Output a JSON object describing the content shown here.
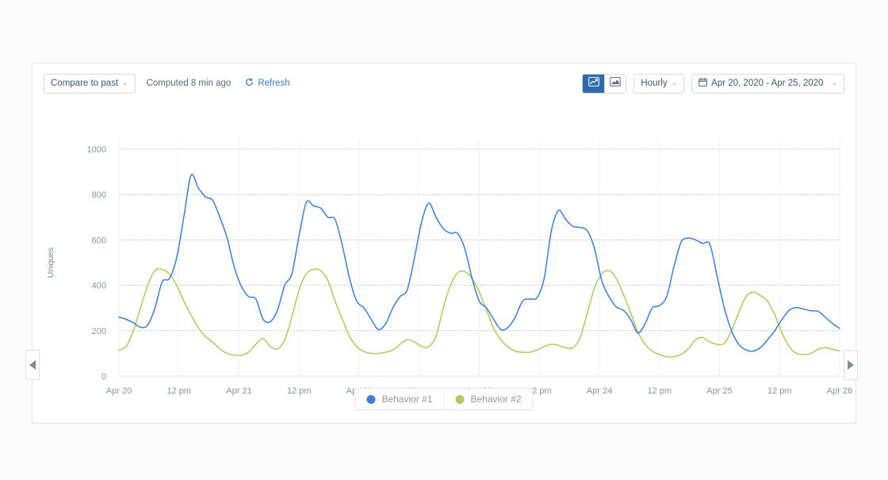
{
  "toolbar": {
    "compare_label": "Compare to past",
    "computed_label": "Computed 8 min ago",
    "refresh_label": "Refresh",
    "refresh_icon": "refresh-icon",
    "caret_glyph": "⌄",
    "chart_type_line_icon": "line-chart-icon",
    "chart_type_area_icon": "area-chart-icon",
    "granularity_label": "Hourly",
    "date_range_label": "Apr 20, 2020 - Apr 25, 2020",
    "calendar_icon": "calendar-icon"
  },
  "nav": {
    "prev_icon": "chevron-left-icon",
    "next_icon": "chevron-right-icon"
  },
  "legend": {
    "items": [
      {
        "label": "Behavior #1",
        "color": "#3b7dd8",
        "icon": "legend-dot-icon"
      },
      {
        "label": "Behavior #2",
        "color": "#a9cc5d",
        "icon": "legend-dot-icon"
      }
    ]
  },
  "chart_data": {
    "type": "line",
    "title": "",
    "xlabel": "",
    "ylabel": "Uniques",
    "ylim": [
      0,
      1000
    ],
    "yticks": [
      0,
      200,
      400,
      600,
      800,
      1000
    ],
    "xlim": [
      "Apr 20",
      "Apr 26"
    ],
    "xtick_labels": [
      "Apr 20",
      "12 pm",
      "Apr 21",
      "12 pm",
      "Apr 22",
      "12 pm",
      "Apr 23",
      "12 pm",
      "Apr 24",
      "12 pm",
      "Apr 25",
      "12 pm",
      "Apr 26"
    ],
    "grid": true,
    "grid_style": "dotted",
    "legend_position": "bottom",
    "granularity": "hourly",
    "x_days": 6,
    "series": [
      {
        "name": "Behavior #1",
        "color": "#3b7dd8",
        "values": [
          260,
          250,
          235,
          215,
          225,
          300,
          415,
          430,
          520,
          700,
          885,
          830,
          790,
          775,
          700,
          610,
          480,
          395,
          350,
          340,
          250,
          240,
          290,
          400,
          450,
          620,
          765,
          750,
          740,
          700,
          690,
          575,
          430,
          330,
          300,
          250,
          205,
          230,
          300,
          350,
          380,
          520,
          680,
          762,
          700,
          650,
          630,
          628,
          560,
          430,
          330,
          300,
          250,
          205,
          215,
          260,
          330,
          340,
          345,
          430,
          640,
          730,
          690,
          660,
          655,
          640,
          560,
          420,
          350,
          305,
          290,
          250,
          190,
          230,
          300,
          310,
          350,
          480,
          590,
          608,
          600,
          585,
          580,
          440,
          300,
          200,
          140,
          115,
          110,
          125,
          160,
          200,
          250,
          290,
          302,
          295,
          288,
          285,
          260,
          232,
          210
        ]
      },
      {
        "name": "Behavior #2",
        "color": "#a9cc5d",
        "values": [
          115,
          130,
          200,
          300,
          400,
          465,
          470,
          450,
          400,
          330,
          270,
          215,
          175,
          150,
          120,
          100,
          92,
          92,
          105,
          140,
          165,
          130,
          120,
          160,
          260,
          380,
          450,
          470,
          465,
          420,
          330,
          250,
          175,
          130,
          108,
          100,
          100,
          105,
          115,
          140,
          160,
          150,
          130,
          130,
          175,
          300,
          400,
          455,
          460,
          430,
          370,
          290,
          210,
          160,
          128,
          110,
          105,
          105,
          115,
          130,
          140,
          135,
          125,
          125,
          170,
          280,
          390,
          450,
          465,
          430,
          360,
          280,
          195,
          140,
          110,
          95,
          85,
          85,
          95,
          120,
          160,
          170,
          150,
          140,
          145,
          200,
          280,
          350,
          370,
          355,
          330,
          270,
          190,
          130,
          100,
          95,
          100,
          118,
          125,
          118,
          110
        ]
      }
    ]
  }
}
